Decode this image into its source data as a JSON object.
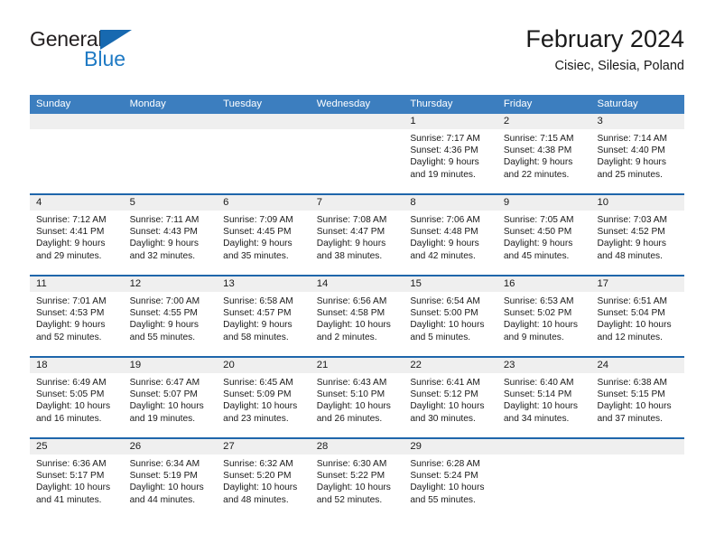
{
  "brand": {
    "line1": "General",
    "line2": "Blue",
    "triangle_color": "#1769b0",
    "text_color": "#231f20",
    "blue_color": "#1f7ac4"
  },
  "header": {
    "title": "February 2024",
    "subtitle": "Cisiec, Silesia, Poland"
  },
  "theme": {
    "header_bg": "#3c7ebf",
    "row_divider": "#1f66ab",
    "daynum_band": "#efefef",
    "text": "#1a1a1a"
  },
  "calendar": {
    "weekday_headers": [
      "Sunday",
      "Monday",
      "Tuesday",
      "Wednesday",
      "Thursday",
      "Friday",
      "Saturday"
    ],
    "weeks": [
      [
        {
          "day": "",
          "lines": []
        },
        {
          "day": "",
          "lines": []
        },
        {
          "day": "",
          "lines": []
        },
        {
          "day": "",
          "lines": []
        },
        {
          "day": "1",
          "lines": [
            "Sunrise: 7:17 AM",
            "Sunset: 4:36 PM",
            "Daylight: 9 hours",
            "and 19 minutes."
          ]
        },
        {
          "day": "2",
          "lines": [
            "Sunrise: 7:15 AM",
            "Sunset: 4:38 PM",
            "Daylight: 9 hours",
            "and 22 minutes."
          ]
        },
        {
          "day": "3",
          "lines": [
            "Sunrise: 7:14 AM",
            "Sunset: 4:40 PM",
            "Daylight: 9 hours",
            "and 25 minutes."
          ]
        }
      ],
      [
        {
          "day": "4",
          "lines": [
            "Sunrise: 7:12 AM",
            "Sunset: 4:41 PM",
            "Daylight: 9 hours",
            "and 29 minutes."
          ]
        },
        {
          "day": "5",
          "lines": [
            "Sunrise: 7:11 AM",
            "Sunset: 4:43 PM",
            "Daylight: 9 hours",
            "and 32 minutes."
          ]
        },
        {
          "day": "6",
          "lines": [
            "Sunrise: 7:09 AM",
            "Sunset: 4:45 PM",
            "Daylight: 9 hours",
            "and 35 minutes."
          ]
        },
        {
          "day": "7",
          "lines": [
            "Sunrise: 7:08 AM",
            "Sunset: 4:47 PM",
            "Daylight: 9 hours",
            "and 38 minutes."
          ]
        },
        {
          "day": "8",
          "lines": [
            "Sunrise: 7:06 AM",
            "Sunset: 4:48 PM",
            "Daylight: 9 hours",
            "and 42 minutes."
          ]
        },
        {
          "day": "9",
          "lines": [
            "Sunrise: 7:05 AM",
            "Sunset: 4:50 PM",
            "Daylight: 9 hours",
            "and 45 minutes."
          ]
        },
        {
          "day": "10",
          "lines": [
            "Sunrise: 7:03 AM",
            "Sunset: 4:52 PM",
            "Daylight: 9 hours",
            "and 48 minutes."
          ]
        }
      ],
      [
        {
          "day": "11",
          "lines": [
            "Sunrise: 7:01 AM",
            "Sunset: 4:53 PM",
            "Daylight: 9 hours",
            "and 52 minutes."
          ]
        },
        {
          "day": "12",
          "lines": [
            "Sunrise: 7:00 AM",
            "Sunset: 4:55 PM",
            "Daylight: 9 hours",
            "and 55 minutes."
          ]
        },
        {
          "day": "13",
          "lines": [
            "Sunrise: 6:58 AM",
            "Sunset: 4:57 PM",
            "Daylight: 9 hours",
            "and 58 minutes."
          ]
        },
        {
          "day": "14",
          "lines": [
            "Sunrise: 6:56 AM",
            "Sunset: 4:58 PM",
            "Daylight: 10 hours",
            "and 2 minutes."
          ]
        },
        {
          "day": "15",
          "lines": [
            "Sunrise: 6:54 AM",
            "Sunset: 5:00 PM",
            "Daylight: 10 hours",
            "and 5 minutes."
          ]
        },
        {
          "day": "16",
          "lines": [
            "Sunrise: 6:53 AM",
            "Sunset: 5:02 PM",
            "Daylight: 10 hours",
            "and 9 minutes."
          ]
        },
        {
          "day": "17",
          "lines": [
            "Sunrise: 6:51 AM",
            "Sunset: 5:04 PM",
            "Daylight: 10 hours",
            "and 12 minutes."
          ]
        }
      ],
      [
        {
          "day": "18",
          "lines": [
            "Sunrise: 6:49 AM",
            "Sunset: 5:05 PM",
            "Daylight: 10 hours",
            "and 16 minutes."
          ]
        },
        {
          "day": "19",
          "lines": [
            "Sunrise: 6:47 AM",
            "Sunset: 5:07 PM",
            "Daylight: 10 hours",
            "and 19 minutes."
          ]
        },
        {
          "day": "20",
          "lines": [
            "Sunrise: 6:45 AM",
            "Sunset: 5:09 PM",
            "Daylight: 10 hours",
            "and 23 minutes."
          ]
        },
        {
          "day": "21",
          "lines": [
            "Sunrise: 6:43 AM",
            "Sunset: 5:10 PM",
            "Daylight: 10 hours",
            "and 26 minutes."
          ]
        },
        {
          "day": "22",
          "lines": [
            "Sunrise: 6:41 AM",
            "Sunset: 5:12 PM",
            "Daylight: 10 hours",
            "and 30 minutes."
          ]
        },
        {
          "day": "23",
          "lines": [
            "Sunrise: 6:40 AM",
            "Sunset: 5:14 PM",
            "Daylight: 10 hours",
            "and 34 minutes."
          ]
        },
        {
          "day": "24",
          "lines": [
            "Sunrise: 6:38 AM",
            "Sunset: 5:15 PM",
            "Daylight: 10 hours",
            "and 37 minutes."
          ]
        }
      ],
      [
        {
          "day": "25",
          "lines": [
            "Sunrise: 6:36 AM",
            "Sunset: 5:17 PM",
            "Daylight: 10 hours",
            "and 41 minutes."
          ]
        },
        {
          "day": "26",
          "lines": [
            "Sunrise: 6:34 AM",
            "Sunset: 5:19 PM",
            "Daylight: 10 hours",
            "and 44 minutes."
          ]
        },
        {
          "day": "27",
          "lines": [
            "Sunrise: 6:32 AM",
            "Sunset: 5:20 PM",
            "Daylight: 10 hours",
            "and 48 minutes."
          ]
        },
        {
          "day": "28",
          "lines": [
            "Sunrise: 6:30 AM",
            "Sunset: 5:22 PM",
            "Daylight: 10 hours",
            "and 52 minutes."
          ]
        },
        {
          "day": "29",
          "lines": [
            "Sunrise: 6:28 AM",
            "Sunset: 5:24 PM",
            "Daylight: 10 hours",
            "and 55 minutes."
          ]
        },
        {
          "day": "",
          "lines": []
        },
        {
          "day": "",
          "lines": []
        }
      ]
    ]
  }
}
